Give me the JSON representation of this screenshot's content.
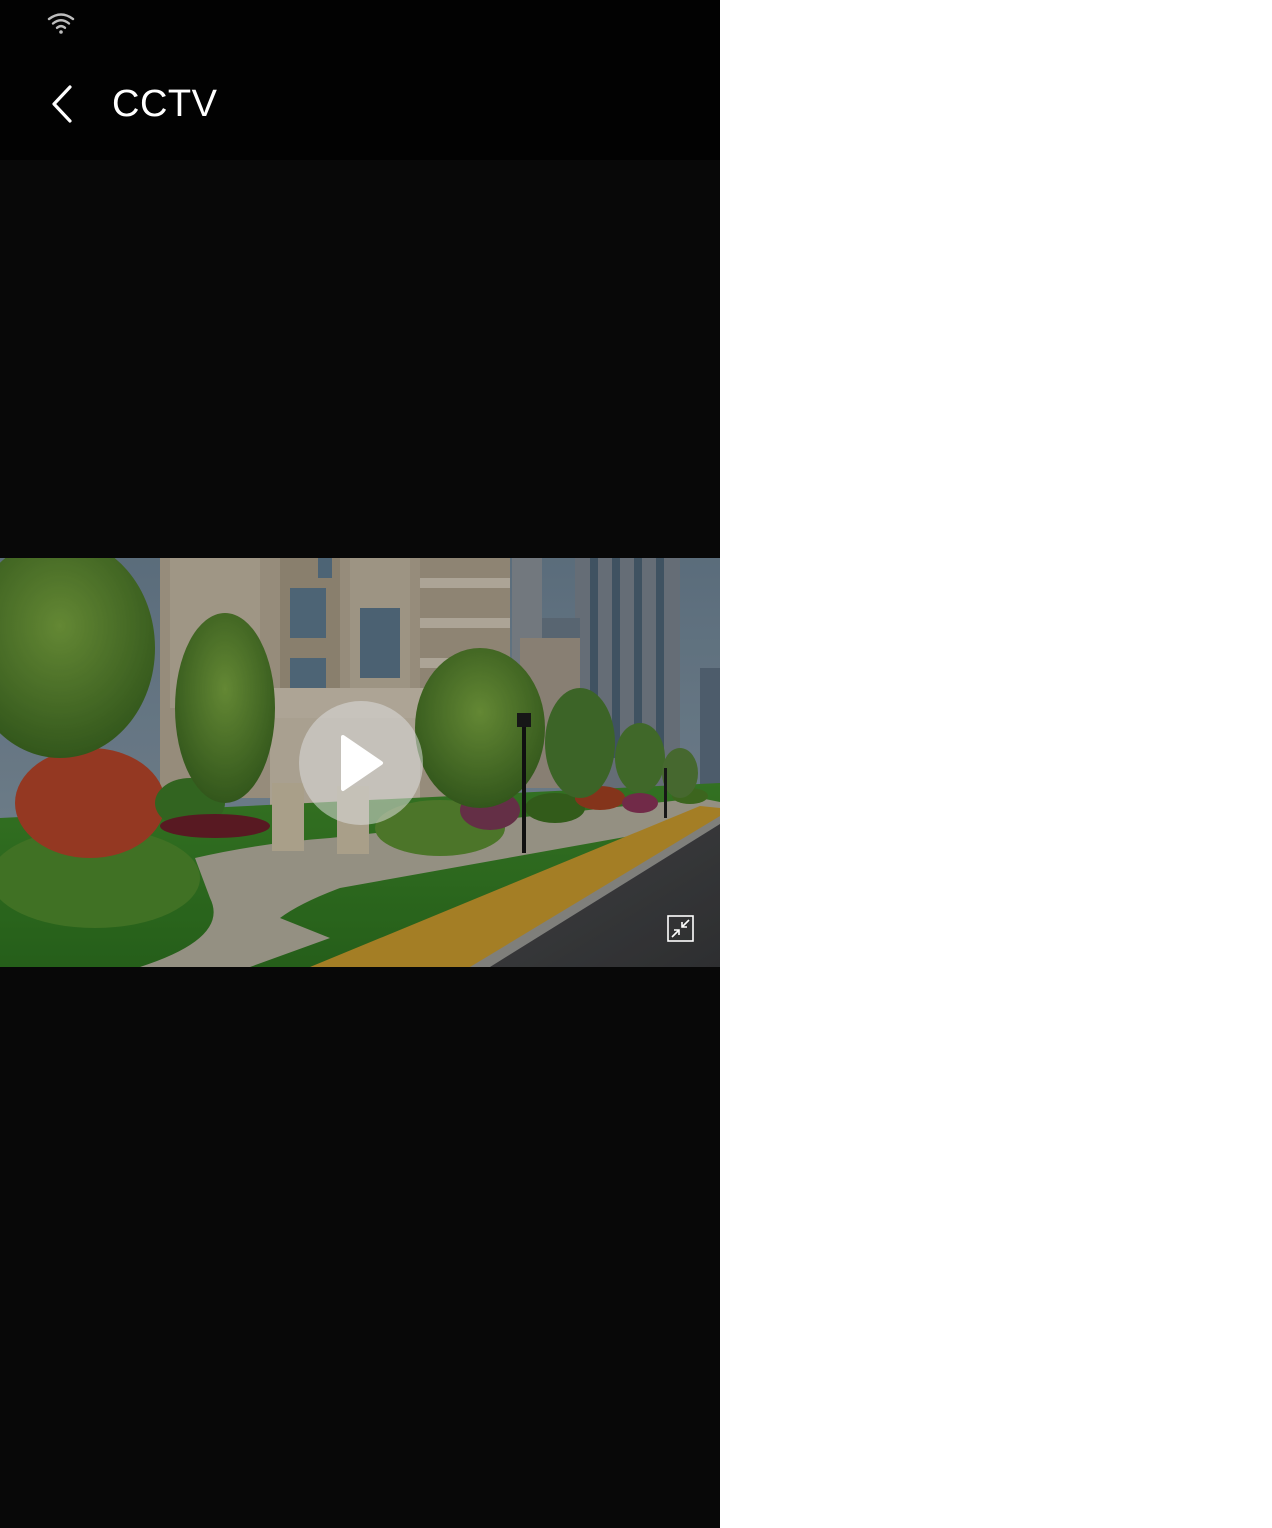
{
  "status_bar": {
    "wifi_icon": "wifi-icon"
  },
  "header": {
    "back_icon": "chevron-left-icon",
    "title": "CCTV"
  },
  "video_player": {
    "play_icon": "play-icon",
    "minimize_icon": "exit-fullscreen-icon"
  }
}
